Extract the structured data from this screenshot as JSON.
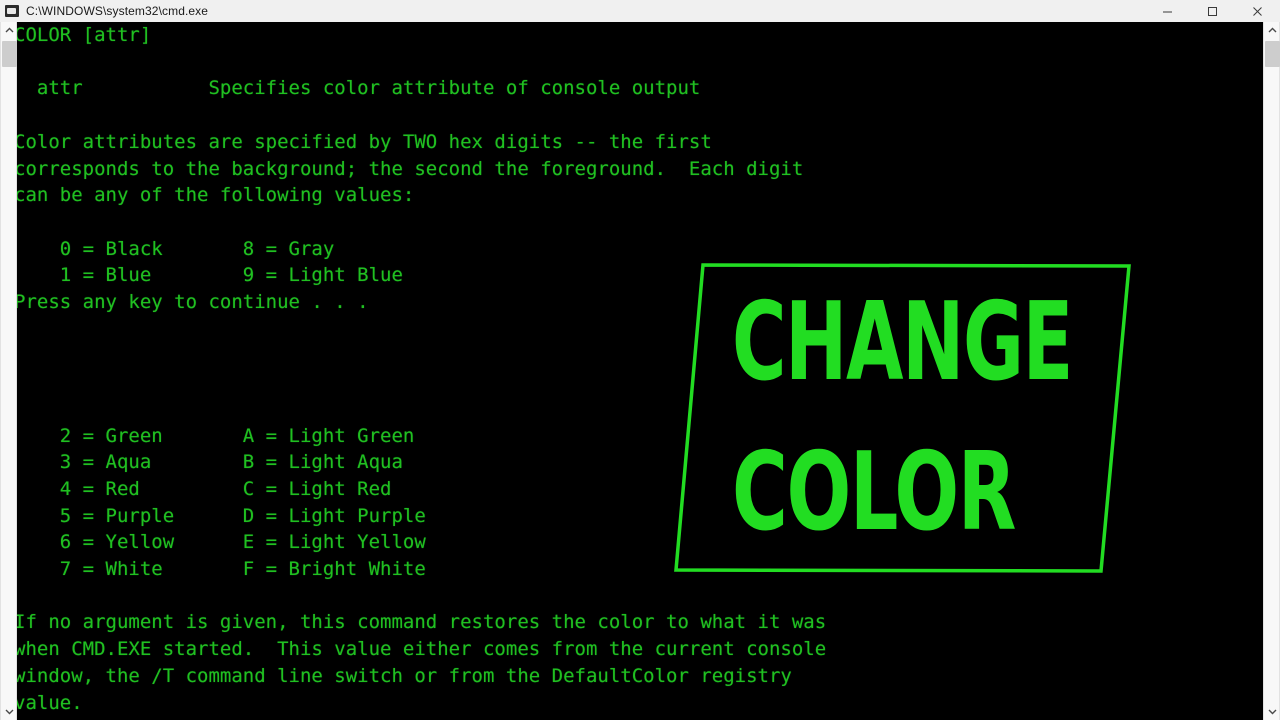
{
  "window": {
    "title": "C:\\WINDOWS\\system32\\cmd.exe",
    "icon": "cmd-console-icon",
    "controls": {
      "minimize": "Minimize",
      "maximize": "Maximize",
      "close": "Close"
    }
  },
  "theme": {
    "console_background": "#000000",
    "console_foreground": "#20c020",
    "overlay_green": "#22dd22",
    "titlebar_background": "#f0f0f0",
    "titlebar_foreground": "#1a1a1a",
    "scrollbar_track": "#f8f8f8",
    "scrollbar_thumb": "#cdcdcd"
  },
  "console": {
    "text": "COLOR [attr]\n\n  attr           Specifies color attribute of console output\n\nColor attributes are specified by TWO hex digits -- the first\ncorresponds to the background; the second the foreground.  Each digit\ncan be any of the following values:\n\n    0 = Black       8 = Gray\n    1 = Blue        9 = Light Blue\nPress any key to continue . . .\n\n\n\n\n    2 = Green       A = Light Green\n    3 = Aqua        B = Light Aqua\n    4 = Red         C = Light Red\n    5 = Purple      D = Light Purple\n    6 = Yellow      E = Light Yellow\n    7 = White       F = Bright White\n\nIf no argument is given, this command restores the color to what it was\nwhen CMD.EXE started.  This value either comes from the current console\nwindow, the /T command line switch or from the DefaultColor registry\nvalue.",
    "lines": [
      "COLOR [attr]",
      "",
      "  attr           Specifies color attribute of console output",
      "",
      "Color attributes are specified by TWO hex digits -- the first",
      "corresponds to the background; the second the foreground.  Each digit",
      "can be any of the following values:",
      "",
      "    0 = Black       8 = Gray",
      "    1 = Blue        9 = Light Blue",
      "Press any key to continue . . .",
      "",
      "",
      "",
      "",
      "    2 = Green       A = Light Green",
      "    3 = Aqua        B = Light Aqua",
      "    4 = Red         C = Light Red",
      "    5 = Purple      D = Light Purple",
      "    6 = Yellow      E = Light Yellow",
      "    7 = White       F = Bright White",
      "",
      "If no argument is given, this command restores the color to what it was",
      "when CMD.EXE started.  This value either comes from the current console",
      "window, the /T command line switch or from the DefaultColor registry",
      "value."
    ],
    "command": "COLOR [attr]",
    "argument_description": "attr           Specifies color attribute of console output",
    "prompt": "Press any key to continue . . .",
    "color_codes": [
      {
        "code": "0",
        "name": "Black",
        "alt_code": "8",
        "alt_name": "Gray"
      },
      {
        "code": "1",
        "name": "Blue",
        "alt_code": "9",
        "alt_name": "Light Blue"
      },
      {
        "code": "2",
        "name": "Green",
        "alt_code": "A",
        "alt_name": "Light Green"
      },
      {
        "code": "3",
        "name": "Aqua",
        "alt_code": "B",
        "alt_name": "Light Aqua"
      },
      {
        "code": "4",
        "name": "Red",
        "alt_code": "C",
        "alt_name": "Light Red"
      },
      {
        "code": "5",
        "name": "Purple",
        "alt_code": "D",
        "alt_name": "Light Purple"
      },
      {
        "code": "6",
        "name": "Yellow",
        "alt_code": "E",
        "alt_name": "Light Yellow"
      },
      {
        "code": "7",
        "name": "White",
        "alt_code": "F",
        "alt_name": "Bright White"
      }
    ]
  },
  "overlay": {
    "line1": "CHANGE",
    "line2": "COLOR",
    "frame_shape": "skewed-rectangle-outline"
  },
  "scrollbars": {
    "left": {
      "up_arrow": "scroll-up",
      "down_arrow": "scroll-down"
    },
    "right": {
      "up_arrow": "scroll-up",
      "down_arrow": "scroll-down"
    }
  }
}
